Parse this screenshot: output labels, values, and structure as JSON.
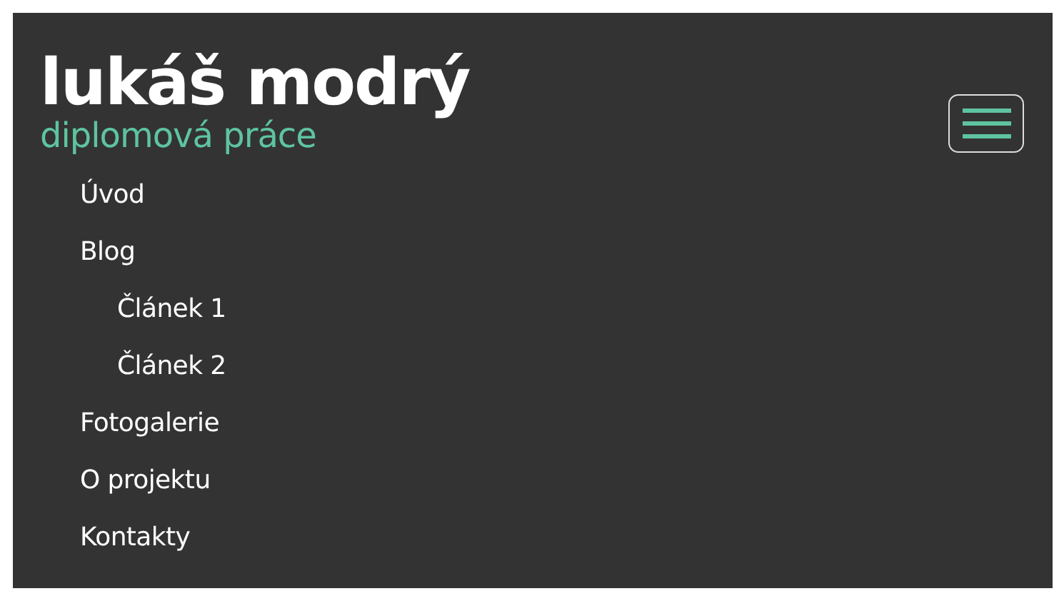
{
  "header": {
    "title": "lukáš modrý",
    "subtitle": "diplomová práce"
  },
  "menu_button": {
    "expanded": true
  },
  "menu": [
    {
      "label": "Úvod"
    },
    {
      "label": "Blog",
      "children": [
        {
          "label": "Článek 1"
        },
        {
          "label": "Článek 2"
        }
      ]
    },
    {
      "label": "Fotogalerie"
    },
    {
      "label": "O projektu"
    },
    {
      "label": "Kontakty"
    }
  ]
}
